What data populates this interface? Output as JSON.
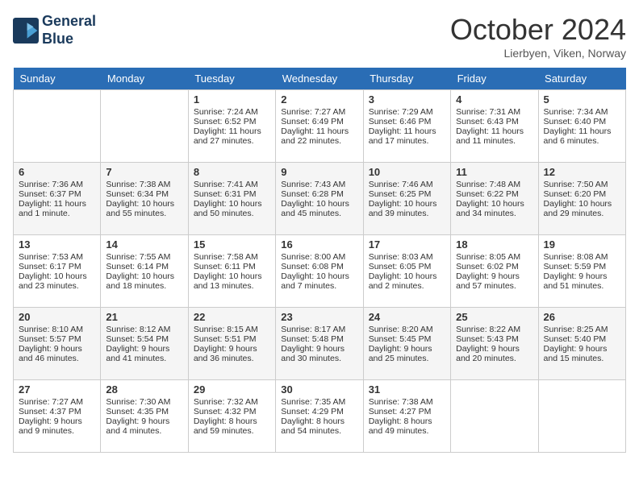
{
  "header": {
    "logo_line1": "General",
    "logo_line2": "Blue",
    "month": "October 2024",
    "location": "Lierbyen, Viken, Norway"
  },
  "weekdays": [
    "Sunday",
    "Monday",
    "Tuesday",
    "Wednesday",
    "Thursday",
    "Friday",
    "Saturday"
  ],
  "weeks": [
    [
      {
        "day": "",
        "text": ""
      },
      {
        "day": "",
        "text": ""
      },
      {
        "day": "1",
        "text": "Sunrise: 7:24 AM\nSunset: 6:52 PM\nDaylight: 11 hours\nand 27 minutes."
      },
      {
        "day": "2",
        "text": "Sunrise: 7:27 AM\nSunset: 6:49 PM\nDaylight: 11 hours\nand 22 minutes."
      },
      {
        "day": "3",
        "text": "Sunrise: 7:29 AM\nSunset: 6:46 PM\nDaylight: 11 hours\nand 17 minutes."
      },
      {
        "day": "4",
        "text": "Sunrise: 7:31 AM\nSunset: 6:43 PM\nDaylight: 11 hours\nand 11 minutes."
      },
      {
        "day": "5",
        "text": "Sunrise: 7:34 AM\nSunset: 6:40 PM\nDaylight: 11 hours\nand 6 minutes."
      }
    ],
    [
      {
        "day": "6",
        "text": "Sunrise: 7:36 AM\nSunset: 6:37 PM\nDaylight: 11 hours\nand 1 minute."
      },
      {
        "day": "7",
        "text": "Sunrise: 7:38 AM\nSunset: 6:34 PM\nDaylight: 10 hours\nand 55 minutes."
      },
      {
        "day": "8",
        "text": "Sunrise: 7:41 AM\nSunset: 6:31 PM\nDaylight: 10 hours\nand 50 minutes."
      },
      {
        "day": "9",
        "text": "Sunrise: 7:43 AM\nSunset: 6:28 PM\nDaylight: 10 hours\nand 45 minutes."
      },
      {
        "day": "10",
        "text": "Sunrise: 7:46 AM\nSunset: 6:25 PM\nDaylight: 10 hours\nand 39 minutes."
      },
      {
        "day": "11",
        "text": "Sunrise: 7:48 AM\nSunset: 6:22 PM\nDaylight: 10 hours\nand 34 minutes."
      },
      {
        "day": "12",
        "text": "Sunrise: 7:50 AM\nSunset: 6:20 PM\nDaylight: 10 hours\nand 29 minutes."
      }
    ],
    [
      {
        "day": "13",
        "text": "Sunrise: 7:53 AM\nSunset: 6:17 PM\nDaylight: 10 hours\nand 23 minutes."
      },
      {
        "day": "14",
        "text": "Sunrise: 7:55 AM\nSunset: 6:14 PM\nDaylight: 10 hours\nand 18 minutes."
      },
      {
        "day": "15",
        "text": "Sunrise: 7:58 AM\nSunset: 6:11 PM\nDaylight: 10 hours\nand 13 minutes."
      },
      {
        "day": "16",
        "text": "Sunrise: 8:00 AM\nSunset: 6:08 PM\nDaylight: 10 hours\nand 7 minutes."
      },
      {
        "day": "17",
        "text": "Sunrise: 8:03 AM\nSunset: 6:05 PM\nDaylight: 10 hours\nand 2 minutes."
      },
      {
        "day": "18",
        "text": "Sunrise: 8:05 AM\nSunset: 6:02 PM\nDaylight: 9 hours\nand 57 minutes."
      },
      {
        "day": "19",
        "text": "Sunrise: 8:08 AM\nSunset: 5:59 PM\nDaylight: 9 hours\nand 51 minutes."
      }
    ],
    [
      {
        "day": "20",
        "text": "Sunrise: 8:10 AM\nSunset: 5:57 PM\nDaylight: 9 hours\nand 46 minutes."
      },
      {
        "day": "21",
        "text": "Sunrise: 8:12 AM\nSunset: 5:54 PM\nDaylight: 9 hours\nand 41 minutes."
      },
      {
        "day": "22",
        "text": "Sunrise: 8:15 AM\nSunset: 5:51 PM\nDaylight: 9 hours\nand 36 minutes."
      },
      {
        "day": "23",
        "text": "Sunrise: 8:17 AM\nSunset: 5:48 PM\nDaylight: 9 hours\nand 30 minutes."
      },
      {
        "day": "24",
        "text": "Sunrise: 8:20 AM\nSunset: 5:45 PM\nDaylight: 9 hours\nand 25 minutes."
      },
      {
        "day": "25",
        "text": "Sunrise: 8:22 AM\nSunset: 5:43 PM\nDaylight: 9 hours\nand 20 minutes."
      },
      {
        "day": "26",
        "text": "Sunrise: 8:25 AM\nSunset: 5:40 PM\nDaylight: 9 hours\nand 15 minutes."
      }
    ],
    [
      {
        "day": "27",
        "text": "Sunrise: 7:27 AM\nSunset: 4:37 PM\nDaylight: 9 hours\nand 9 minutes."
      },
      {
        "day": "28",
        "text": "Sunrise: 7:30 AM\nSunset: 4:35 PM\nDaylight: 9 hours\nand 4 minutes."
      },
      {
        "day": "29",
        "text": "Sunrise: 7:32 AM\nSunset: 4:32 PM\nDaylight: 8 hours\nand 59 minutes."
      },
      {
        "day": "30",
        "text": "Sunrise: 7:35 AM\nSunset: 4:29 PM\nDaylight: 8 hours\nand 54 minutes."
      },
      {
        "day": "31",
        "text": "Sunrise: 7:38 AM\nSunset: 4:27 PM\nDaylight: 8 hours\nand 49 minutes."
      },
      {
        "day": "",
        "text": ""
      },
      {
        "day": "",
        "text": ""
      }
    ]
  ]
}
